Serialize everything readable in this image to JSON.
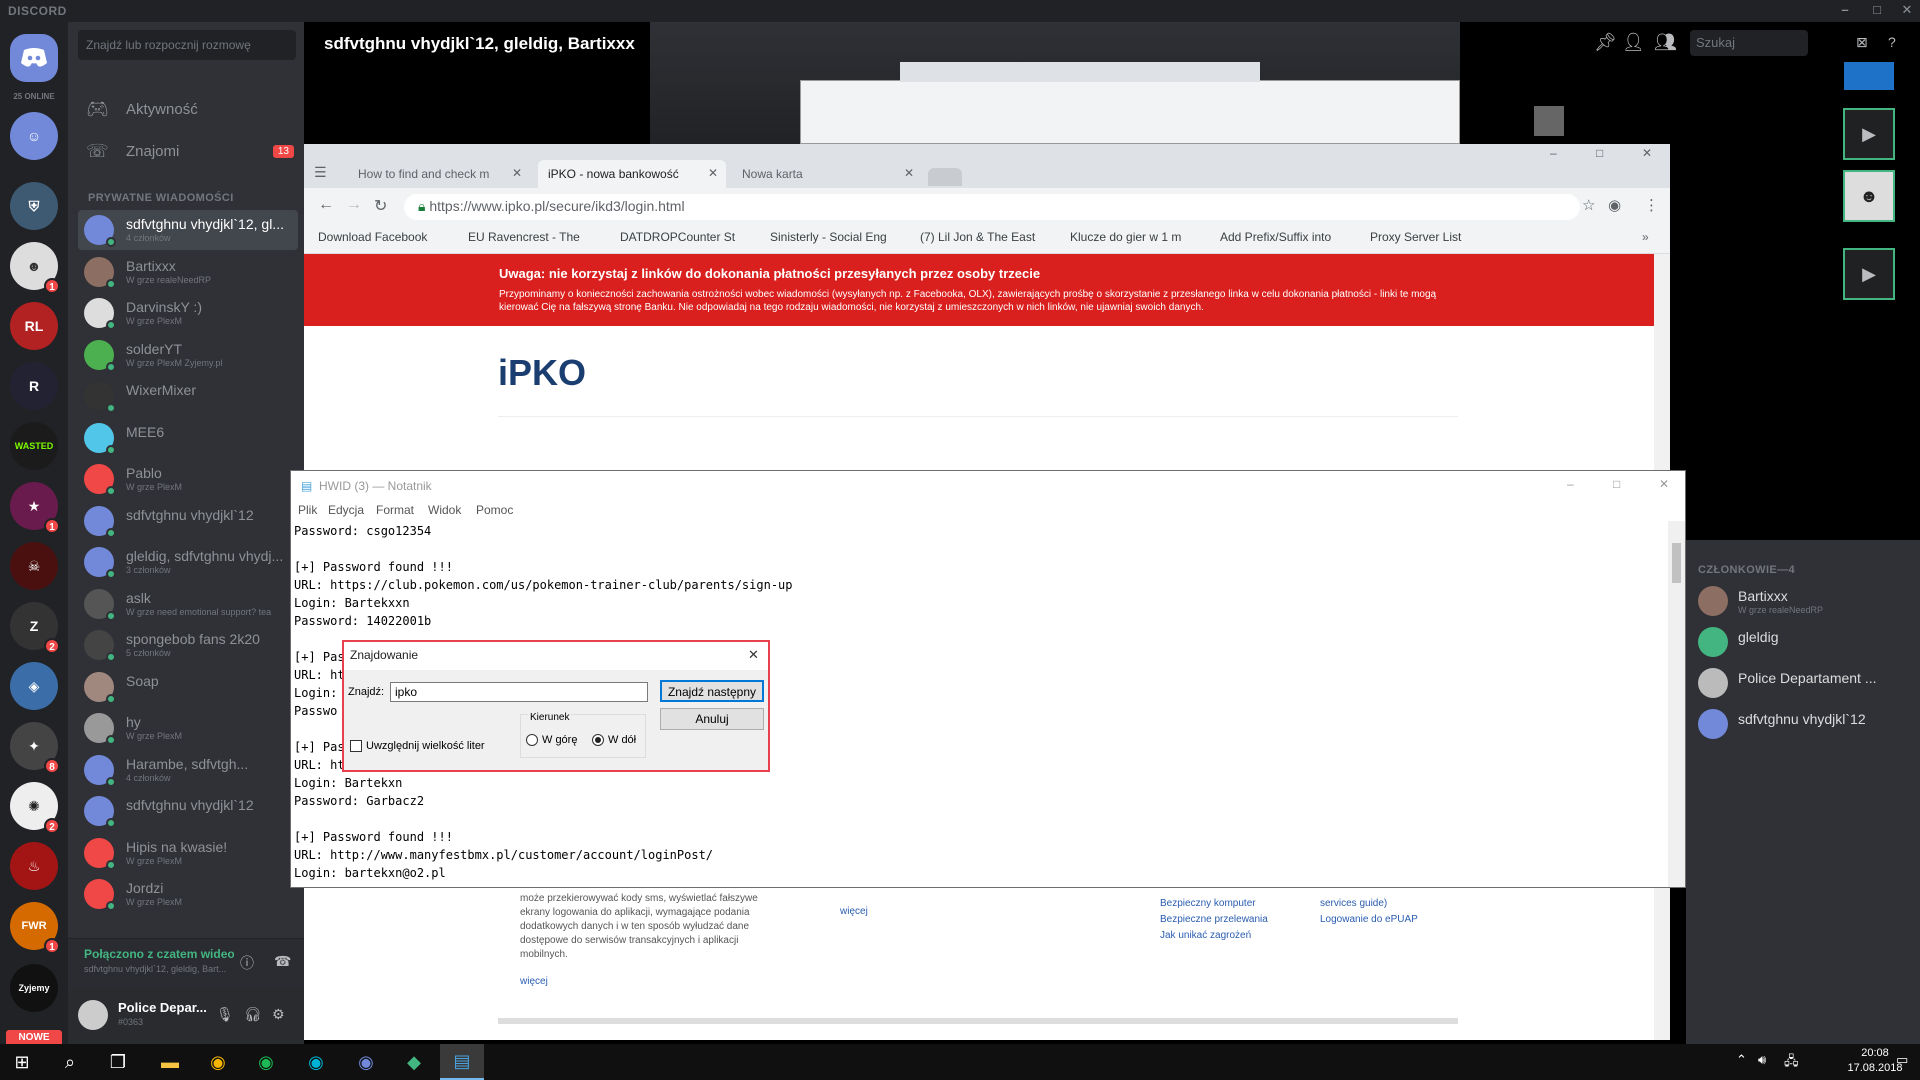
{
  "discord": {
    "app_title": "DISCORD",
    "online_count": "25 ONLINE",
    "search_placeholder": "Znajdź lub rozpocznij rozmowę",
    "nav": [
      {
        "label": "Aktywność",
        "badge": ""
      },
      {
        "label": "Znajomi",
        "badge": "13"
      }
    ],
    "pm_header": "PRYWATNE WIADOMOŚCI",
    "dms": [
      {
        "name": "sdfvtghnu vhydjkl`12, gl...",
        "sub": "4 członków",
        "active": true
      },
      {
        "name": "Bartixxx",
        "sub": "W grze realeNeedRP"
      },
      {
        "name": "DarvinskY :)",
        "sub": "W grze PlexM"
      },
      {
        "name": "solderYT",
        "sub": "W grze PlexM Zyjemy.pl"
      },
      {
        "name": "WixerMixer",
        "sub": ""
      },
      {
        "name": "MEE6",
        "sub": ""
      },
      {
        "name": "Pablo",
        "sub": "W grze PlexM"
      },
      {
        "name": "sdfvtghnu vhydjkl`12",
        "sub": ""
      },
      {
        "name": "gleldig, sdfvtghnu vhydj...",
        "sub": "3 członków"
      },
      {
        "name": "aslk",
        "sub": "W grze need emotional support? tea"
      },
      {
        "name": "spongebob fans 2k20",
        "sub": "5 członków"
      },
      {
        "name": "Soap",
        "sub": ""
      },
      {
        "name": "hy",
        "sub": "W grze PlexM"
      },
      {
        "name": "Harambe, sdfvtgh...",
        "sub": "4 członków"
      },
      {
        "name": "sdfvtghnu vhydjkl`12",
        "sub": ""
      },
      {
        "name": "Hipis na kwasie!",
        "sub": "W grze PlexM"
      },
      {
        "name": "Jordzi",
        "sub": "W grze PlexM"
      }
    ],
    "voice": {
      "status": "Połączono z czatem wideo",
      "channel": "sdfvtghnu vhydjkl`12, gleldig, Bart..."
    },
    "user": {
      "name": "Police Depar...",
      "tag": "#0363"
    },
    "new_badge": "NOWE",
    "call_title": "sdfvtghnu vhydjkl`12, gleldig, Bartixxx",
    "top_search_placeholder": "Szukaj",
    "members_header": "CZŁONKOWIE—4",
    "members": [
      {
        "name": "Bartixxx",
        "sub": "W grze realeNeedRP"
      },
      {
        "name": "gleldig",
        "sub": ""
      },
      {
        "name": "Police Departament ...",
        "sub": ""
      },
      {
        "name": "sdfvtghnu vhydjkl`12",
        "sub": ""
      }
    ]
  },
  "chrome": {
    "tabs": [
      {
        "label": "How to find and check m"
      },
      {
        "label": "iPKO - nowa bankowość"
      },
      {
        "label": "Nowa karta"
      }
    ],
    "url": "https://www.ipko.pl/secure/ikd3/login.html",
    "bookmarks": [
      "Download Facebook",
      "EU Ravencrest - The",
      "DATDROPCounter St",
      "Sinisterly - Social Eng",
      "(7) Lil Jon & The East",
      "Klucze do gier w 1 m",
      "Add Prefix/Suffix into",
      "Proxy Server List"
    ],
    "warning_title": "Uwaga: nie korzystaj z linków do dokonania płatności przesyłanych przez osoby trzecie",
    "warning_text": "Przypominamy o konieczności zachowania ostrożności wobec wiadomości (wysyłanych np. z Facebooka, OLX), zawierających prośbę o skorzystanie z przesłanego linka w celu dokonania płatności - linki te mogą kierować Cię na fałszywą stronę Banku. Nie odpowiadaj na tego rodzaju wiadomości, nie korzystaj z umieszczonych w nich linków, nie ujawniaj swoich danych.",
    "logo": "iPKO",
    "footer_left": "może przekierowywać kody sms, wyświetlać fałszywe ekrany logowania do aplikacji, wymagające podania dodatkowych danych i w ten sposób wyłudzać dane dostępowe do serwisów transakcyjnych i aplikacji mobilnych.",
    "footer_more": "więcej",
    "footer_more2": "więcej",
    "footer_links": [
      "Bezpieczny komputer",
      "Bezpieczne przelewania",
      "Jak unikać zagrożeń"
    ],
    "footer_links2": [
      "services guide)",
      "Logowanie do ePUAP"
    ]
  },
  "notepad": {
    "title": "HWID (3) — Notatnik",
    "menu": [
      "Plik",
      "Edycja",
      "Format",
      "Widok",
      "Pomoc"
    ],
    "lines": [
      "Password: csgo12354",
      "",
      "[+] Password found !!!",
      "URL: https://club.pokemon.com/us/pokemon-trainer-club/parents/sign-up",
      "Login: Bartekxxn",
      "Password: 14022001b",
      "",
      "[+] Pass",
      "URL: htt",
      "Login: b",
      "Passwo",
      "",
      "[+] Pass",
      "URL: htt",
      "Login: Bartekxn",
      "Password: Garbacz2",
      "",
      "[+] Password found !!!",
      "URL: http://www.manyfestbmx.pl/customer/account/loginPost/",
      "Login: bartekxn@o2.pl"
    ]
  },
  "find_dialog": {
    "title": "Znajdowanie",
    "find_label": "Znajdź:",
    "find_value": "ipko",
    "find_next": "Znajdź następny",
    "cancel": "Anuluj",
    "direction_label": "Kierunek",
    "up": "W górę",
    "down": "W dół",
    "direction_selected": "down",
    "match_case": "Uwzględnij wielkość liter"
  },
  "taskbar": {
    "time": "20:08",
    "date": "17.08.2018"
  },
  "colors": {
    "discord_bg": "#2f3136",
    "discord_dark": "#202225",
    "blurple": "#7289da",
    "online": "#43b581",
    "mention": "#f04747",
    "pko_red": "#d9201e",
    "pko_blue": "#1b3e70"
  }
}
